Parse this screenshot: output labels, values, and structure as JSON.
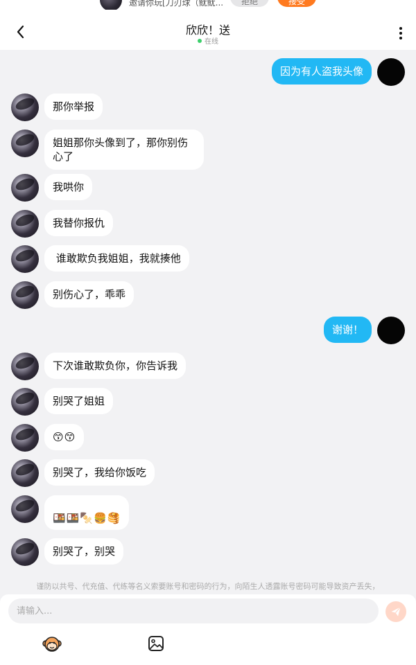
{
  "invite": {
    "text": "邀请你玩[刀刃球（鱿鱿...",
    "decline_label": "拒绝",
    "accept_label": "接受"
  },
  "header": {
    "title": "欣欣！送",
    "status": "在线"
  },
  "messages": [
    {
      "side": "self",
      "text": "因为有人盗我头像"
    },
    {
      "side": "peer",
      "text": "那你举报"
    },
    {
      "side": "peer",
      "line1": "姐姐那你头像到了，那你别伤",
      "line2": "心了"
    },
    {
      "side": "peer",
      "text": "我哄你"
    },
    {
      "side": "peer",
      "text": "我替你报仇"
    },
    {
      "side": "peer",
      "text": " 谁敢欺负我姐姐，我就揍他"
    },
    {
      "side": "peer",
      "text": "别伤心了，乖乖"
    },
    {
      "side": "self",
      "text": "谢谢！"
    },
    {
      "side": "peer",
      "text": "下次谁敢欺负你，你告诉我"
    },
    {
      "side": "peer",
      "text": "别哭了姐姐"
    },
    {
      "side": "peer",
      "text": "😙😙"
    },
    {
      "side": "peer",
      "text": "别哭了，我给你饭吃"
    },
    {
      "side": "peer",
      "text": "🍱🍱🍢🍔🥞"
    },
    {
      "side": "peer",
      "text": "别哭了，别哭"
    }
  ],
  "disclaimer": "谨防以共号、代充值、代练等名义索要账号和密码的行为，向陌生人透露账号密码可能导致资产丢失，",
  "composer": {
    "placeholder": "请输入...",
    "send_icon": "send-icon",
    "emoji_icon": "monkey-face-icon",
    "image_icon": "image-icon",
    "send_color": "#ffd7c8"
  },
  "colors": {
    "self_bubble": "#22b8f4",
    "peer_bubble": "#ffffff",
    "background": "#f2f2f4",
    "accept_button": "#ff7a1f",
    "online": "#3ccf6b"
  }
}
